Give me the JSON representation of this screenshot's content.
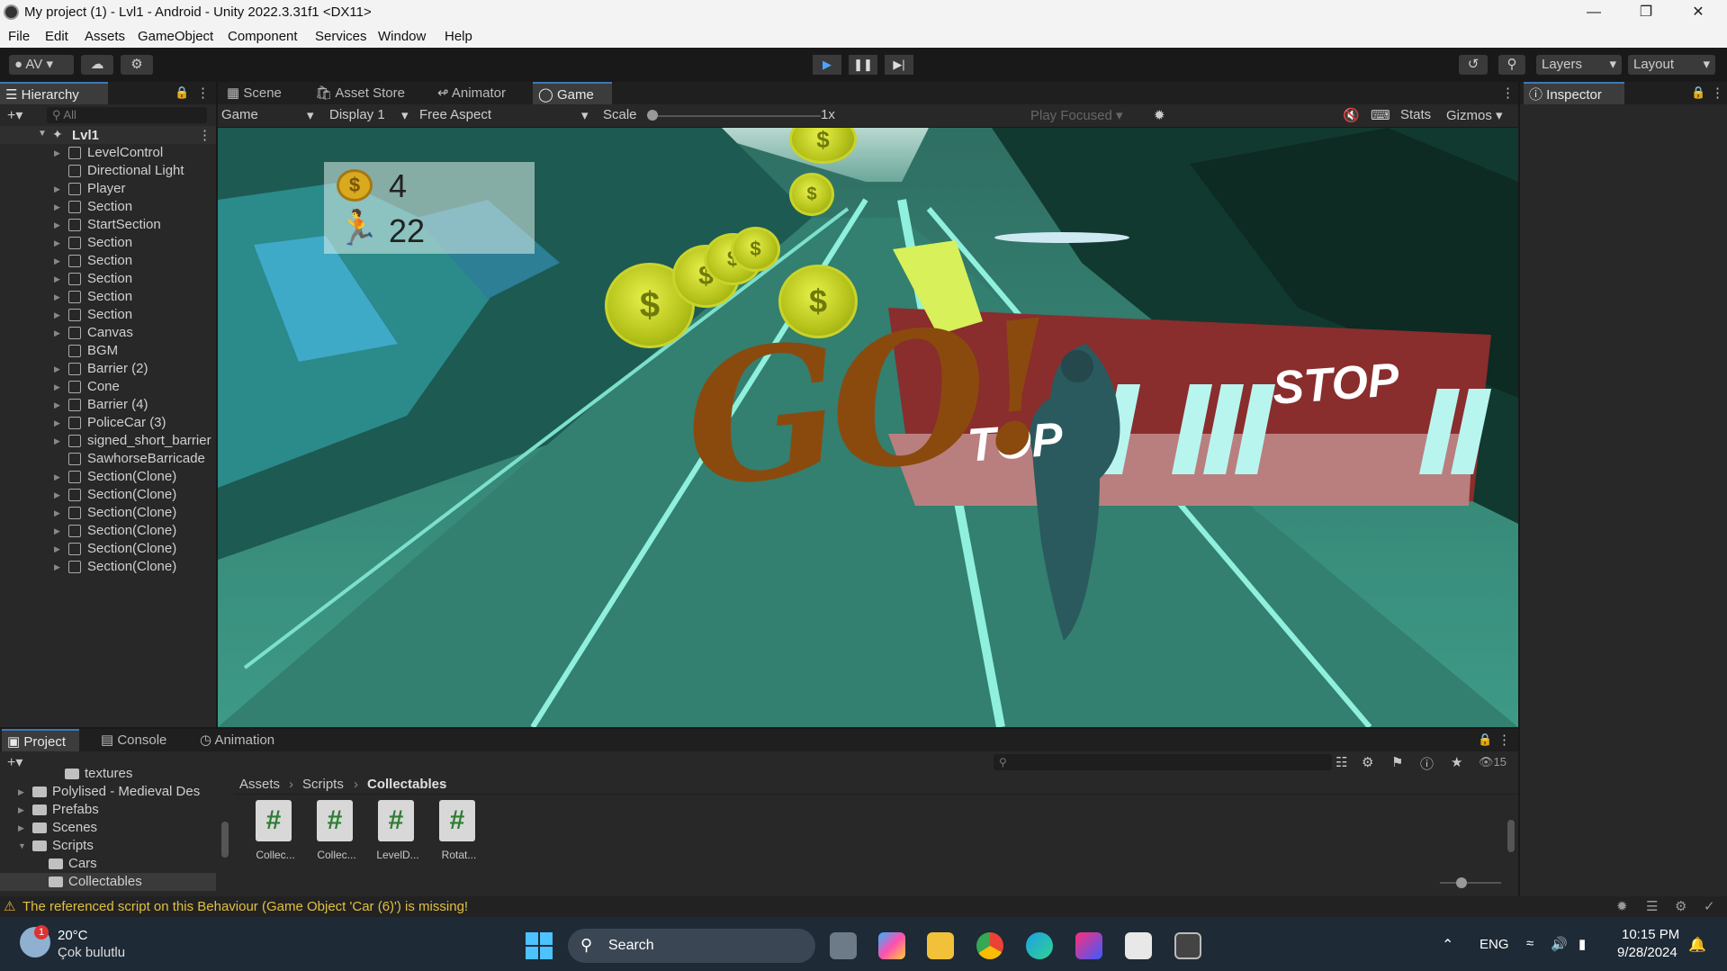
{
  "window": {
    "title": "My project (1) - Lvl1 - Android - Unity 2022.3.31f1 <DX11>"
  },
  "menu": [
    "File",
    "Edit",
    "Assets",
    "GameObject",
    "Component",
    "Services",
    "Window",
    "Help"
  ],
  "toolbar": {
    "account": "AV",
    "layers": "Layers",
    "layout": "Layout"
  },
  "hierarchy": {
    "tab": "Hierarchy",
    "search_placeholder": "All",
    "scene": "Lvl1",
    "items": [
      {
        "label": "LevelControl",
        "expandable": true
      },
      {
        "label": "Directional Light",
        "expandable": false
      },
      {
        "label": "Player",
        "expandable": true
      },
      {
        "label": "Section",
        "expandable": true
      },
      {
        "label": "StartSection",
        "expandable": true
      },
      {
        "label": "Section",
        "expandable": true
      },
      {
        "label": "Section",
        "expandable": true
      },
      {
        "label": "Section",
        "expandable": true
      },
      {
        "label": "Section",
        "expandable": true
      },
      {
        "label": "Section",
        "expandable": true
      },
      {
        "label": "Canvas",
        "expandable": true
      },
      {
        "label": "BGM",
        "expandable": false
      },
      {
        "label": "Barrier (2)",
        "expandable": true
      },
      {
        "label": "Cone",
        "expandable": true
      },
      {
        "label": "Barrier (4)",
        "expandable": true
      },
      {
        "label": "PoliceCar (3)",
        "expandable": true
      },
      {
        "label": "signed_short_barrier",
        "expandable": true
      },
      {
        "label": "SawhorseBarricade",
        "expandable": false
      },
      {
        "label": "Section(Clone)",
        "expandable": true
      },
      {
        "label": "Section(Clone)",
        "expandable": true
      },
      {
        "label": "Section(Clone)",
        "expandable": true
      },
      {
        "label": "Section(Clone)",
        "expandable": true
      },
      {
        "label": "Section(Clone)",
        "expandable": true
      },
      {
        "label": "Section(Clone)",
        "expandable": true
      }
    ]
  },
  "center_tabs": [
    "Scene",
    "Asset Store",
    "Animator",
    "Game"
  ],
  "gamebar": {
    "mode": "Game",
    "display": "Display 1",
    "aspect": "Free Aspect",
    "scale_label": "Scale",
    "scale_value": "1x",
    "play_focused": "Play Focused",
    "stats": "Stats",
    "gizmos": "Gizmos"
  },
  "game": {
    "coins": "4",
    "distance": "22",
    "overlay_text": "GO!",
    "barrier_text_1": "TOP",
    "barrier_text_2": "STOP"
  },
  "inspector": {
    "tab": "Inspector"
  },
  "bottom_tabs": [
    "Project",
    "Console",
    "Animation"
  ],
  "project": {
    "tree": [
      {
        "label": "textures",
        "indent": 3,
        "arrow": ""
      },
      {
        "label": "Polylised - Medieval Des",
        "indent": 1,
        "arrow": "▶"
      },
      {
        "label": "Prefabs",
        "indent": 1,
        "arrow": "▶"
      },
      {
        "label": "Scenes",
        "indent": 1,
        "arrow": "▶"
      },
      {
        "label": "Scripts",
        "indent": 1,
        "arrow": "▼"
      },
      {
        "label": "Cars",
        "indent": 2,
        "arrow": ""
      },
      {
        "label": "Collectables",
        "indent": 2,
        "arrow": ""
      }
    ],
    "breadcrumb": [
      "Assets",
      "Scripts",
      "Collectables"
    ],
    "files": [
      "Collec...",
      "Collec...",
      "LevelD...",
      "Rotat..."
    ],
    "hidden_count": "15"
  },
  "status": {
    "message": "The referenced script on this Behaviour (Game Object 'Car (6)') is missing!"
  },
  "taskbar": {
    "temp": "20°C",
    "weather": "Çok bulutlu",
    "search": "Search",
    "lang": "ENG",
    "time": "10:15 PM",
    "date": "9/28/2024",
    "badge": "1"
  }
}
